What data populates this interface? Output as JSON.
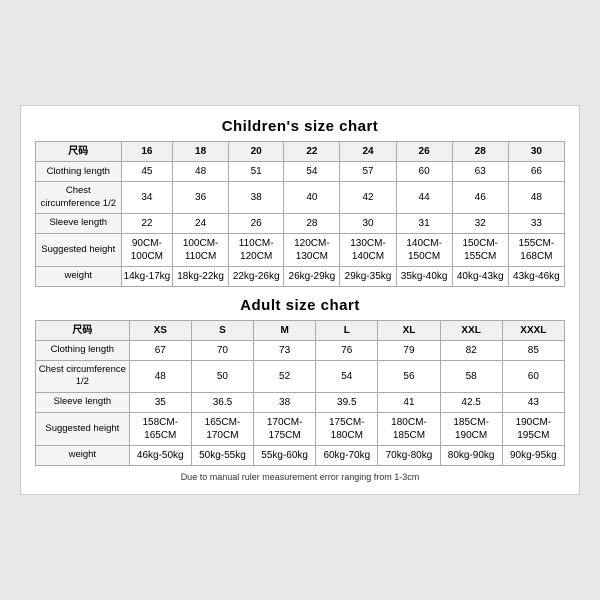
{
  "children_chart": {
    "title": "Children's size chart",
    "columns": [
      "尺码",
      "16",
      "18",
      "20",
      "22",
      "24",
      "26",
      "28",
      "30"
    ],
    "rows": [
      {
        "label": "Clothing length",
        "values": [
          "45",
          "48",
          "51",
          "54",
          "57",
          "60",
          "63",
          "66"
        ]
      },
      {
        "label": "Chest circumference 1/2",
        "values": [
          "34",
          "36",
          "38",
          "40",
          "42",
          "44",
          "46",
          "48"
        ]
      },
      {
        "label": "Sleeve length",
        "values": [
          "22",
          "24",
          "26",
          "28",
          "30",
          "31",
          "32",
          "33"
        ]
      },
      {
        "label": "Suggested height",
        "values": [
          "90CM-100CM",
          "100CM-110CM",
          "110CM-120CM",
          "120CM-130CM",
          "130CM-140CM",
          "140CM-150CM",
          "150CM-155CM",
          "155CM-168CM"
        ]
      },
      {
        "label": "weight",
        "values": [
          "14kg-17kg",
          "18kg-22kg",
          "22kg-26kg",
          "26kg-29kg",
          "29kg-35kg",
          "35kg-40kg",
          "40kg-43kg",
          "43kg-46kg"
        ]
      }
    ]
  },
  "adult_chart": {
    "title": "Adult size chart",
    "columns": [
      "尺码",
      "XS",
      "S",
      "M",
      "L",
      "XL",
      "XXL",
      "XXXL"
    ],
    "rows": [
      {
        "label": "Clothing length",
        "values": [
          "67",
          "70",
          "73",
          "76",
          "79",
          "82",
          "85"
        ]
      },
      {
        "label": "Chest circumference 1/2",
        "values": [
          "48",
          "50",
          "52",
          "54",
          "56",
          "58",
          "60"
        ]
      },
      {
        "label": "Sleeve length",
        "values": [
          "35",
          "36.5",
          "38",
          "39.5",
          "41",
          "42.5",
          "43"
        ]
      },
      {
        "label": "Suggested height",
        "values": [
          "158CM-165CM",
          "165CM-170CM",
          "170CM-175CM",
          "175CM-180CM",
          "180CM-185CM",
          "185CM-190CM",
          "190CM-195CM"
        ]
      },
      {
        "label": "weight",
        "values": [
          "46kg-50kg",
          "50kg-55kg",
          "55kg-60kg",
          "60kg-70kg",
          "70kg-80kg",
          "80kg-90kg",
          "90kg-95kg"
        ]
      }
    ]
  },
  "footnote": "Due to manual ruler measurement error ranging from 1-3cm"
}
